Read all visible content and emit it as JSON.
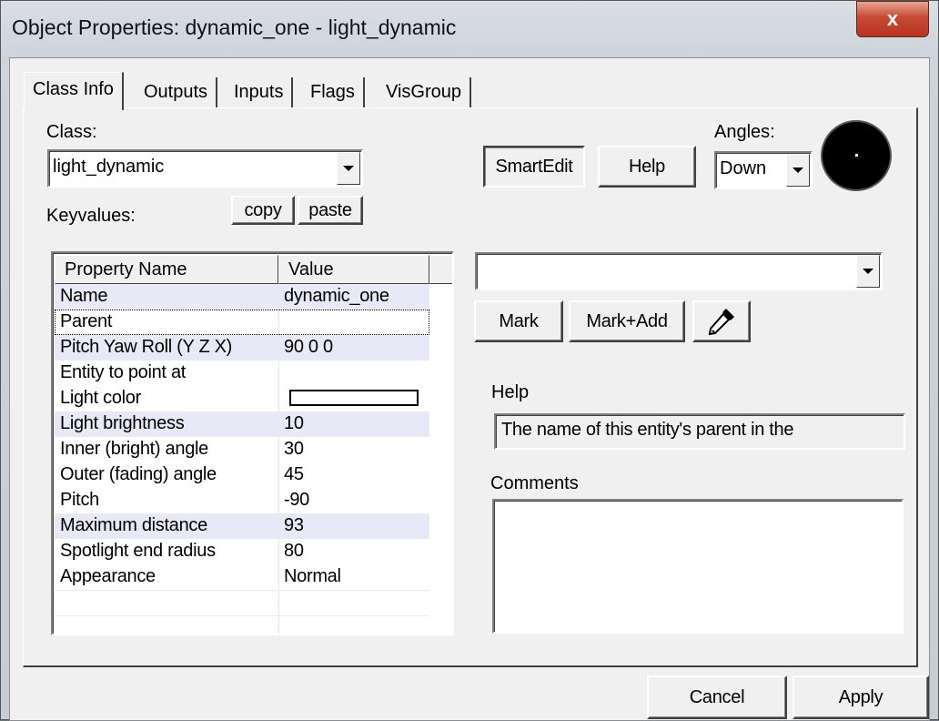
{
  "window": {
    "title": "Object Properties: dynamic_one - light_dynamic",
    "close_label": "x"
  },
  "tabs": [
    {
      "label": "Class Info",
      "active": true
    },
    {
      "label": "Outputs",
      "active": false
    },
    {
      "label": "Inputs",
      "active": false
    },
    {
      "label": "Flags",
      "active": false
    },
    {
      "label": "VisGroup",
      "active": false
    }
  ],
  "class_section": {
    "class_label": "Class:",
    "class_value": "light_dynamic",
    "keyvalues_label": "Keyvalues:",
    "copy_label": "copy",
    "paste_label": "paste"
  },
  "toolbar": {
    "smartedit_label": "SmartEdit",
    "help_label": "Help"
  },
  "angles": {
    "label": "Angles:",
    "value": "Down"
  },
  "property_table": {
    "columns": [
      "Property Name",
      "Value"
    ],
    "rows": [
      {
        "name": "Name",
        "value": "dynamic_one"
      },
      {
        "name": "Parent",
        "value": ""
      },
      {
        "name": "Pitch Yaw Roll (Y Z X)",
        "value": "90 0 0"
      },
      {
        "name": "Entity to point at",
        "value": ""
      },
      {
        "name": "Light color",
        "value": ""
      },
      {
        "name": "Light brightness",
        "value": "10"
      },
      {
        "name": "Inner (bright) angle",
        "value": "30"
      },
      {
        "name": "Outer (fading) angle",
        "value": "45"
      },
      {
        "name": "Pitch",
        "value": "-90"
      },
      {
        "name": "Maximum distance",
        "value": "93"
      },
      {
        "name": "Spotlight end radius",
        "value": "80"
      },
      {
        "name": "Appearance",
        "value": "Normal"
      }
    ]
  },
  "value_editor": {
    "value": "",
    "mark_label": "Mark",
    "mark_add_label": "Mark+Add",
    "eyedropper_icon": "eyedropper-icon"
  },
  "help_section": {
    "label": "Help",
    "text": "The name of this entity's parent in the"
  },
  "comments_section": {
    "label": "Comments",
    "text": ""
  },
  "footer": {
    "cancel_label": "Cancel",
    "apply_label": "Apply"
  },
  "colors": {
    "close_button": "#c74a33",
    "row_highlight": "#e8e8f6",
    "light_color_swatch": "#ffffff"
  }
}
